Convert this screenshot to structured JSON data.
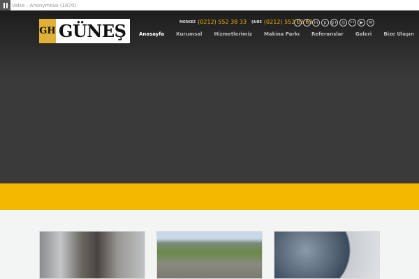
{
  "player": {
    "track": "Valse - Anonymous (1870)"
  },
  "logo": {
    "mark": "GH",
    "name": "GÜNEŞ"
  },
  "contact": {
    "merkez_label": "MERKEZ",
    "merkez_phone": "(0212) 552 38 33",
    "sube_label": "ŞUBE",
    "sube_phone": "(0212) 552 02 69"
  },
  "social": [
    {
      "icon": "twitter-icon",
      "glyph": "t"
    },
    {
      "icon": "facebook-icon",
      "glyph": "f"
    },
    {
      "icon": "linkedin-icon",
      "glyph": "in"
    },
    {
      "icon": "pinterest-icon",
      "glyph": "p"
    },
    {
      "icon": "google-plus-icon",
      "glyph": "g+"
    },
    {
      "icon": "instagram-icon",
      "glyph": "◎"
    },
    {
      "icon": "flickr-icon",
      "glyph": "••"
    },
    {
      "icon": "youtube-icon",
      "glyph": "▶"
    },
    {
      "icon": "mail-icon",
      "glyph": "✉"
    }
  ],
  "nav": [
    "Anasayfa",
    "Kurumsal",
    "Hizmetlerimiz",
    "Makina Parkı",
    "Referanslar",
    "Galeri",
    "Bize Ulaşın"
  ],
  "colors": {
    "accent": "#f5b800",
    "dark": "#3a3a3a"
  }
}
